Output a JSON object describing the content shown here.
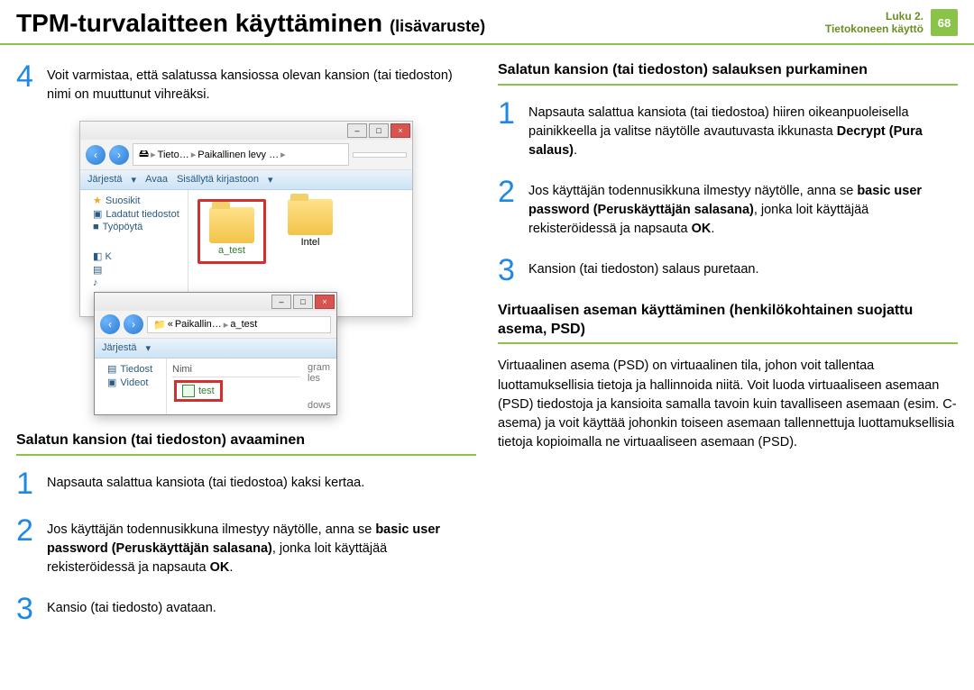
{
  "header": {
    "title_main": "TPM-turvalaitteen käyttäminen",
    "title_sub": "(lisävaruste)",
    "chapter_line1": "Luku 2.",
    "chapter_line2": "Tietokoneen käyttö",
    "page_num": "68"
  },
  "left": {
    "step4": "Voit varmistaa, että salatussa kansiossa olevan kansion (tai tiedoston) nimi on muuttunut vihreäksi.",
    "section_open_title": "Salatun kansion (tai tiedoston) avaaminen",
    "open1": "Napsauta salattua kansiota (tai tiedostoa) kaksi kertaa.",
    "open2_a": "Jos käyttäjän todennusikkuna ilmestyy näytölle, anna se ",
    "open2_b": "basic user password (Peruskäyttäjän salasana)",
    "open2_c": ", jonka loit käyttäjää rekisteröidessä ja napsauta ",
    "open2_d": "OK",
    "open2_e": ".",
    "open3": "Kansio (tai tiedosto) avataan."
  },
  "right": {
    "section_decrypt_title": "Salatun kansion (tai tiedoston) salauksen purkaminen",
    "dec1_a": "Napsauta salattua kansiota (tai tiedostoa) hiiren oikeanpuoleisella painikkeella ja valitse näytölle avautuvasta ikkunasta ",
    "dec1_b": "Decrypt (Pura salaus)",
    "dec1_c": ".",
    "dec2_a": "Jos käyttäjän todennusikkuna ilmestyy näytölle, anna se ",
    "dec2_b": "basic user password (Peruskäyttäjän salasana)",
    "dec2_c": ", jonka loit käyttäjää rekisteröidessä ja napsauta ",
    "dec2_d": "OK",
    "dec2_e": ".",
    "dec3": "Kansion (tai tiedoston) salaus puretaan.",
    "section_psd_title": "Virtuaalisen aseman käyttäminen (henkilökohtainen suojattu asema, PSD)",
    "psd_para": "Virtuaalinen asema (PSD) on virtuaalinen tila, johon voit tallentaa luottamuksellisia tietoja ja hallinnoida niitä. Voit luoda virtuaaliseen asemaan (PSD) tiedostoja ja kansioita samalla tavoin kuin tavalliseen asemaan (esim. C-asema) ja voit käyttää johonkin toiseen asemaan tallennettuja luottamuksellisia tietoja kopioimalla ne virtuaaliseen asemaan (PSD)."
  },
  "explorer_outer": {
    "bc1": "Tieto…",
    "bc2": "Paikallinen levy …",
    "tb_organize": "Järjestä",
    "tb_open": "Avaa",
    "tb_library": "Sisällytä kirjastoon",
    "sb_fav": "Suosikit",
    "sb_downloads": "Ladatut tiedostot",
    "sb_desktop": "Työpöytä",
    "folder_a": "a_test",
    "folder_intel": "Intel",
    "partial_gram": "gram",
    "partial_les": "les",
    "partial_dows": "dows"
  },
  "explorer_inner": {
    "bc1": "Paikallin…",
    "bc2": "a_test",
    "tb_organize": "Järjestä",
    "sb_files": "Tiedost",
    "sb_videos": "Videot",
    "col_name": "Nimi",
    "file_test": "test"
  }
}
